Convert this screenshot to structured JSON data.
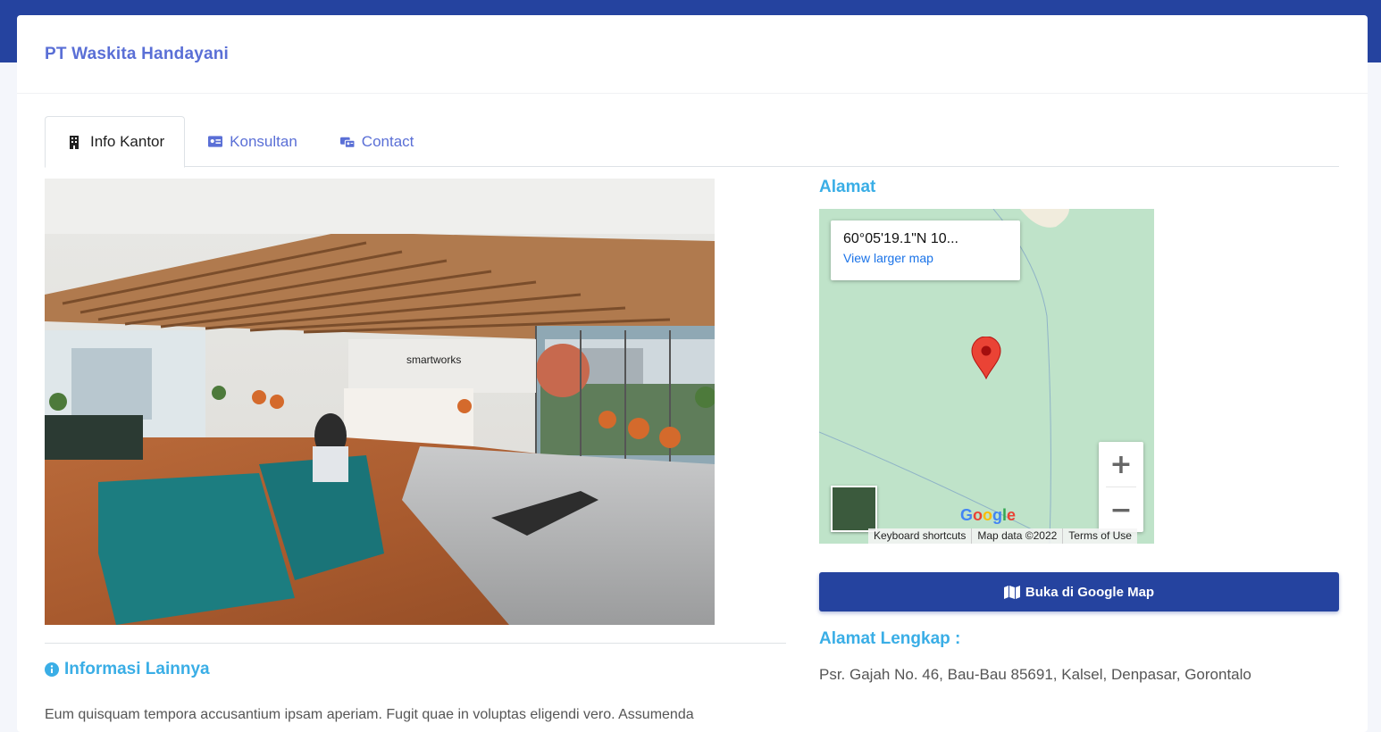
{
  "header": {
    "company_name": "PT Waskita Handayani"
  },
  "tabs": [
    {
      "label": "Info Kantor",
      "icon": "building-icon",
      "active": true
    },
    {
      "label": "Konsultan",
      "icon": "id-card-icon",
      "active": false
    },
    {
      "label": "Contact",
      "icon": "contact-icon",
      "active": false
    }
  ],
  "photo": {
    "sign_text": "smartworks"
  },
  "info": {
    "title": "Informasi Lainnya",
    "text": "Eum quisquam tempora accusantium ipsam aperiam. Fugit quae in voluptas eligendi vero. Assumenda"
  },
  "map_section": {
    "title": "Alamat",
    "coordinates": "60°05'19.1\"N 10...",
    "larger_map_label": "View larger map",
    "zoom_in": "+",
    "zoom_out": "−",
    "google_logo": "Google",
    "footer": [
      "Keyboard shortcuts",
      "Map data ©2022",
      "Terms of Use"
    ]
  },
  "open_map_button": "Buka di Google Map",
  "address_section": {
    "title": "Alamat Lengkap :",
    "address": "Psr. Gajah No. 46, Bau-Bau 85691, Kalsel, Denpasar, Gorontalo"
  },
  "colors": {
    "brand": "#25439f",
    "link": "#5a6fd6",
    "heading": "#3aaee6",
    "map_land": "#bfe3c9"
  }
}
